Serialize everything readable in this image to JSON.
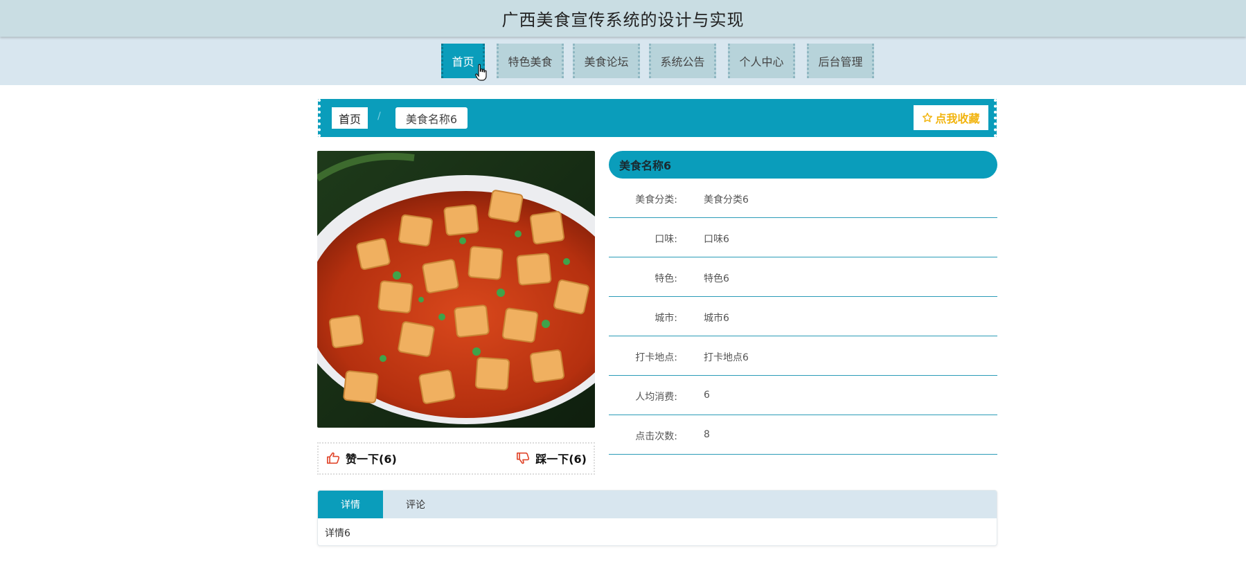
{
  "app": {
    "title": "广西美食宣传系统的设计与实现"
  },
  "nav": {
    "items": [
      {
        "label": "首页",
        "active": true
      },
      {
        "label": "特色美食",
        "active": false
      },
      {
        "label": "美食论坛",
        "active": false
      },
      {
        "label": "系统公告",
        "active": false
      },
      {
        "label": "个人中心",
        "active": false
      },
      {
        "label": "后台管理",
        "active": false
      }
    ]
  },
  "breadcrumb": {
    "home": "首页",
    "separator": "/",
    "current": "美食名称6"
  },
  "favorite": {
    "icon": "star-outline-icon",
    "label": "点我收藏"
  },
  "vote": {
    "like": {
      "icon": "thumbs-up-icon",
      "label": "赞一下(6)"
    },
    "dislike": {
      "icon": "thumbs-down-icon",
      "label": "踩一下(6)"
    }
  },
  "info": {
    "title": "美食名称6",
    "rows": [
      {
        "label": "美食分类:",
        "value": "美食分类6"
      },
      {
        "label": "口味:",
        "value": "口味6"
      },
      {
        "label": "特色:",
        "value": "特色6"
      },
      {
        "label": "城市:",
        "value": "城市6"
      },
      {
        "label": "打卡地点:",
        "value": "打卡地点6"
      },
      {
        "label": "人均消费:",
        "value": "6"
      },
      {
        "label": "点击次数:",
        "value": "8"
      }
    ]
  },
  "tabs": {
    "items": [
      {
        "label": "详情",
        "active": true
      },
      {
        "label": "评论",
        "active": false
      }
    ],
    "content": "详情6"
  },
  "colors": {
    "accent": "#0a9dbb",
    "header_bg": "#c9dde3",
    "nav_bg": "#d8e6ef",
    "nav_item_bg": "#b7d3da",
    "favorite_text": "#f2b40f",
    "vote_icon": "#e0452a"
  }
}
